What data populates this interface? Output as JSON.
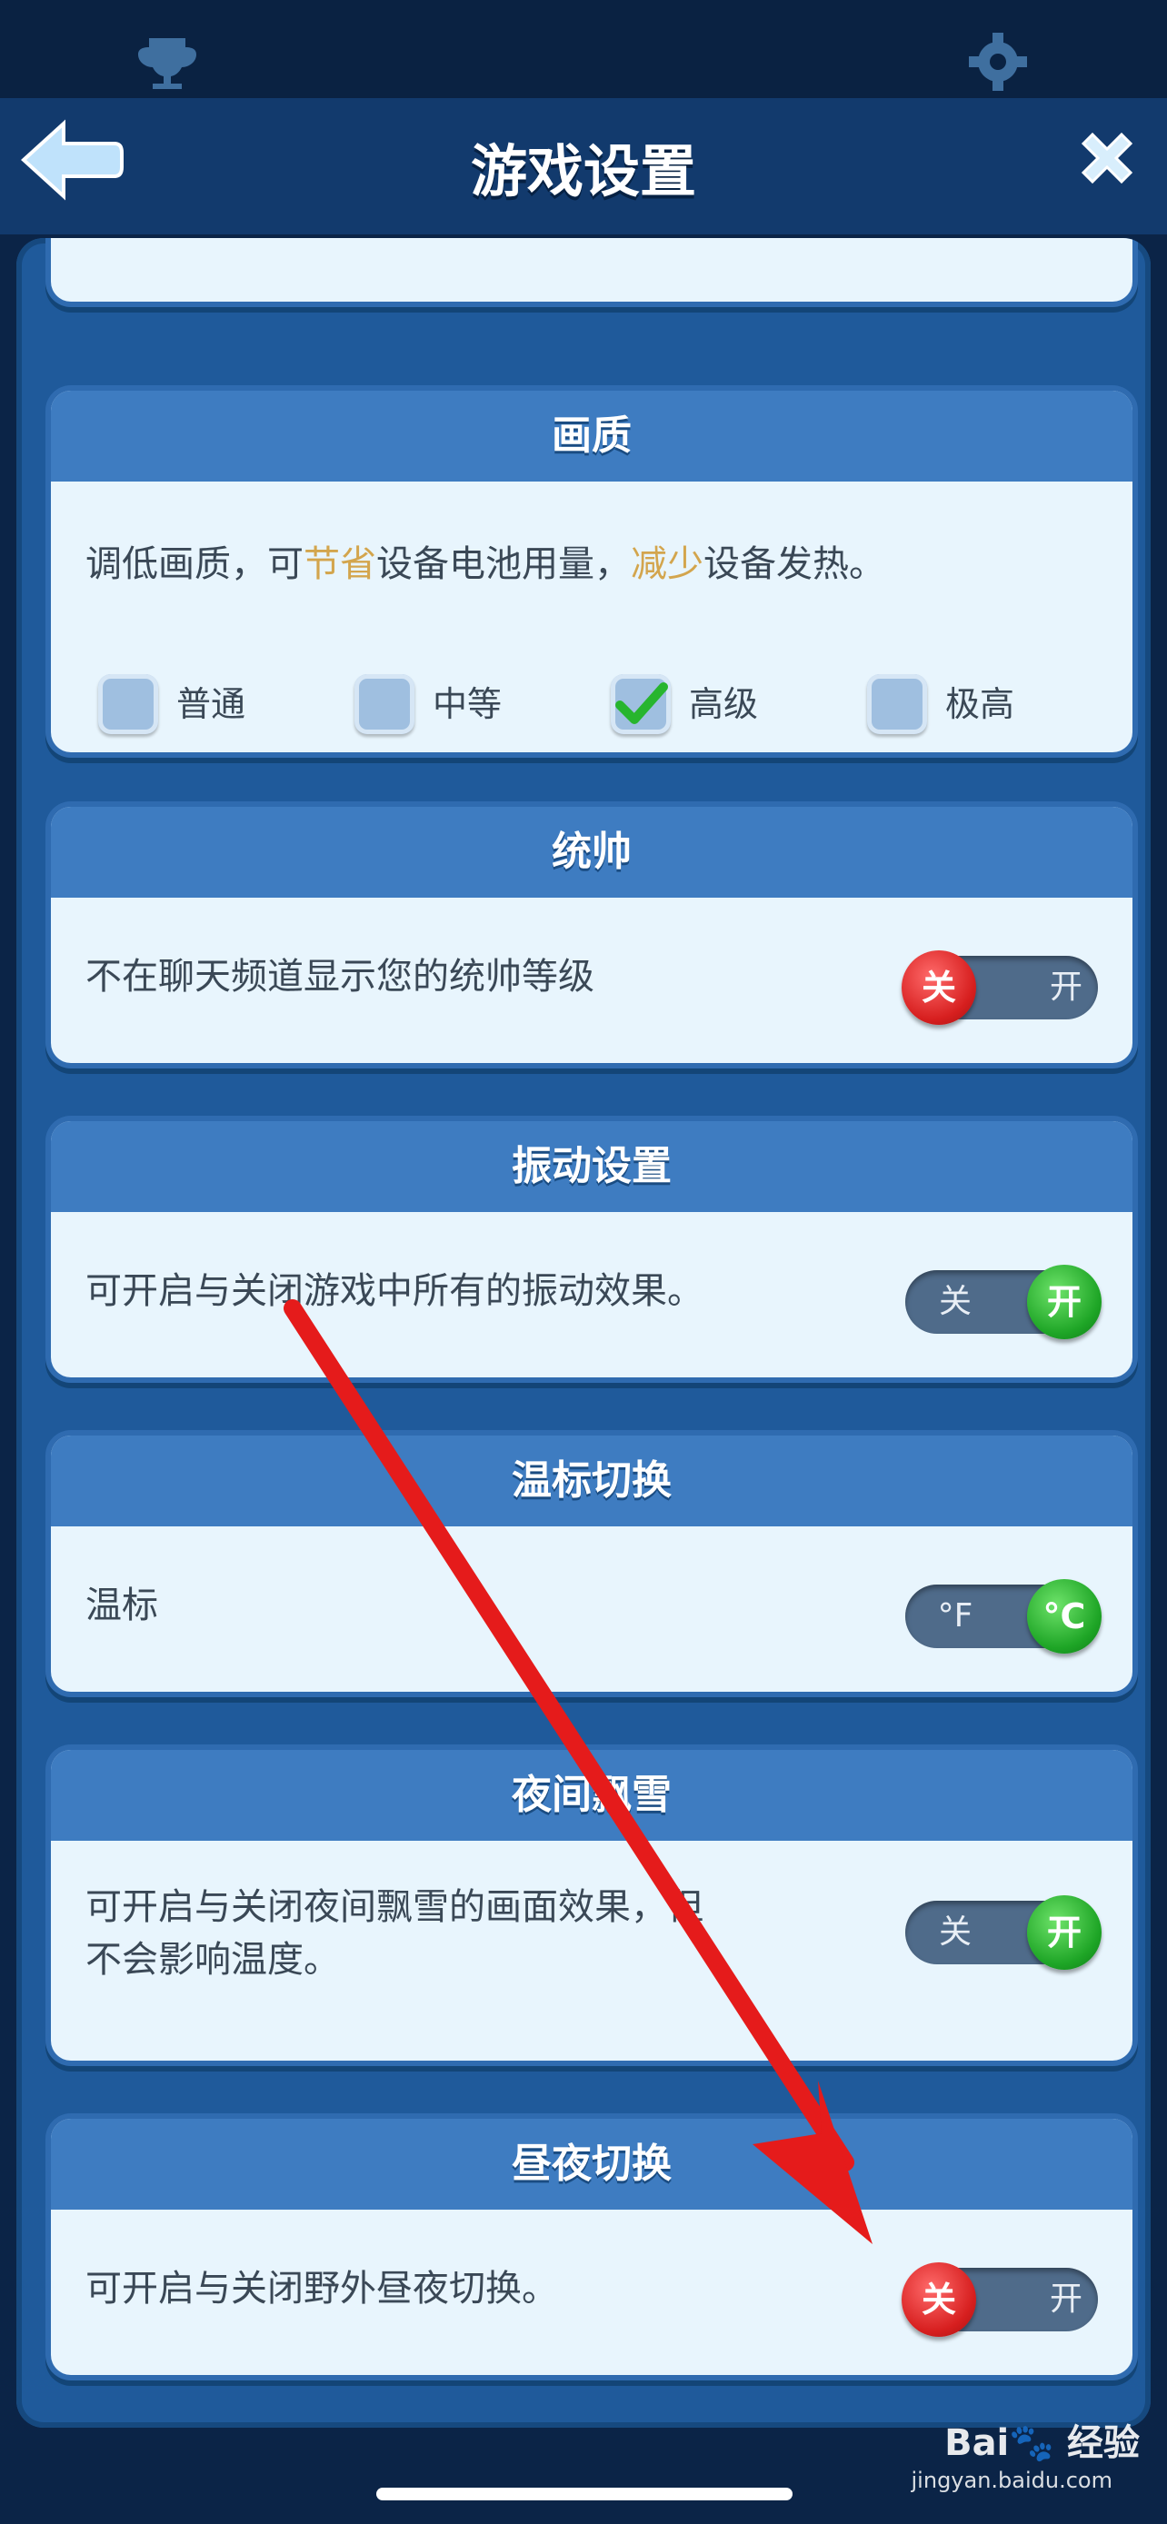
{
  "header": {
    "title": "游戏设置"
  },
  "quality": {
    "title": "画质",
    "desc_1": "调低画质，可",
    "desc_hl1": "节省",
    "desc_2": "设备电池用量，",
    "desc_hl2": "减少",
    "desc_3": "设备发热。",
    "options": [
      {
        "label": "普通",
        "checked": false
      },
      {
        "label": "中等",
        "checked": false
      },
      {
        "label": "高级",
        "checked": true
      },
      {
        "label": "极高",
        "checked": false
      }
    ]
  },
  "commander": {
    "title": "统帅",
    "desc": "不在聊天频道显示您的统帅等级",
    "off": "关",
    "on": "开",
    "state": "off"
  },
  "vibration": {
    "title": "振动设置",
    "desc": "可开启与关闭游戏中所有的振动效果。",
    "off": "关",
    "on": "开",
    "state": "on"
  },
  "temp": {
    "title": "温标切换",
    "desc": "温标",
    "off": "°F",
    "on": "°C",
    "state": "on"
  },
  "snow": {
    "title": "夜间飘雪",
    "desc_line1": "可开启与关闭夜间飘雪的画面效果，但",
    "desc_line2": "不会影响温度。",
    "off": "关",
    "on": "开",
    "state": "on"
  },
  "daynight": {
    "title": "昼夜切换",
    "desc": "可开启与关闭野外昼夜切换。",
    "off": "关",
    "on": "开",
    "state": "off"
  },
  "watermark": {
    "brand": "Bai🐾 经验",
    "site": "jingyan.baidu.com"
  },
  "colors": {
    "accent_red": "#e51b1b",
    "toggle_on": "#1ea526",
    "toggle_off": "#d71f1f",
    "highlight": "#d3a54d"
  }
}
